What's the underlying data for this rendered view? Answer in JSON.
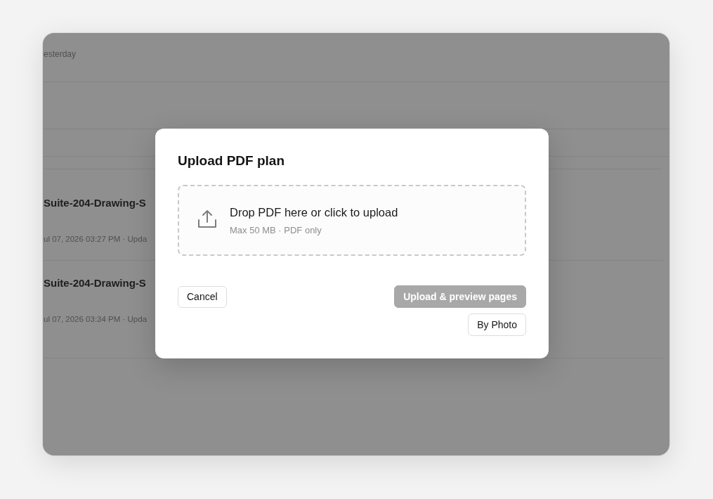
{
  "background_list": {
    "group_label": "esterday",
    "items": [
      {
        "title": "Suite-204-Drawing-S",
        "meta": "ul 07, 2026 03:27 PM · Upda"
      },
      {
        "title": "Suite-204-Drawing-S",
        "meta": "ul 07, 2026 03:34 PM · Upda"
      }
    ]
  },
  "dialog": {
    "title": "Upload PDF plan",
    "dropzone": {
      "prompt": "Drop PDF here or click to upload",
      "hint": "Max 50 MB · PDF only"
    },
    "cancel_button": {
      "label": "Cancel"
    },
    "actions": [
      {
        "label": "Upload & preview pages",
        "kind": "primary",
        "disabled": true
      },
      {
        "label": "By Photo",
        "kind": "secondary",
        "disabled": false
      }
    ]
  }
}
